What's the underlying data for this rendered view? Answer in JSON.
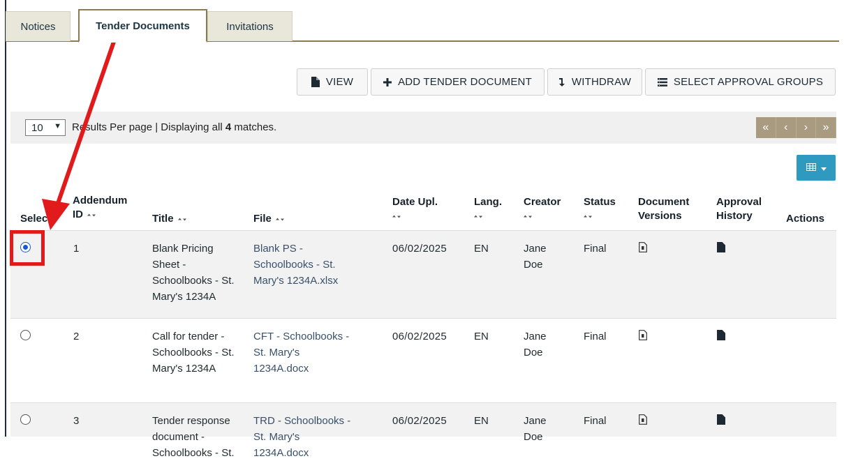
{
  "tabs": [
    {
      "label": "Notices"
    },
    {
      "label": "Tender Documents"
    },
    {
      "label": "Invitations"
    }
  ],
  "toolbar": {
    "view": "VIEW",
    "add": "ADD TENDER DOCUMENT",
    "withdraw": "WITHDRAW",
    "approval_groups": "SELECT APPROVAL GROUPS"
  },
  "results": {
    "per_page": "10",
    "text_before": "Results Per page | Displaying all ",
    "count": "4",
    "text_after": " matches."
  },
  "pager": [
    "«",
    "‹",
    "›",
    "»"
  ],
  "columns": {
    "select": "Select",
    "addendum_1": "Addendum",
    "addendum_2": "ID",
    "title": "Title",
    "file": "File",
    "date": "Date Upl.",
    "lang": "Lang.",
    "creator": "Creator",
    "status": "Status",
    "versions_1": "Document",
    "versions_2": "Versions",
    "approval_1": "Approval",
    "approval_2": "History",
    "actions": "Actions"
  },
  "rows": [
    {
      "selected": true,
      "id": "1",
      "title": [
        "Blank Pricing",
        "Sheet -",
        "Schoolbooks - St.",
        "Mary's 1234A"
      ],
      "file": [
        "Blank PS -",
        "Schoolbooks - St.",
        "Mary's 1234A.xlsx"
      ],
      "date": "06/02/2025",
      "lang": "EN",
      "creator": [
        "Jane",
        "Doe"
      ],
      "status": "Final"
    },
    {
      "selected": false,
      "id": "2",
      "title": [
        "Call for tender -",
        "Schoolbooks - St.",
        "Mary's 1234A"
      ],
      "file": [
        "CFT - Schoolbooks -",
        "St. Mary's",
        "1234A.docx"
      ],
      "date": "06/02/2025",
      "lang": "EN",
      "creator": [
        "Jane",
        "Doe"
      ],
      "status": "Final"
    },
    {
      "selected": false,
      "id": "3",
      "title": [
        "Tender response",
        "document -",
        "Schoolbooks - St."
      ],
      "file": [
        "TRD - Schoolbooks -",
        "St. Mary's",
        "1234A.docx"
      ],
      "date": "06/02/2025",
      "lang": "EN",
      "creator": [
        "Jane",
        "Doe"
      ],
      "status": "Final"
    }
  ],
  "colors": {
    "accent_border": "#8c7a55",
    "pager": "#a89b80",
    "column_button": "#2e9ac0",
    "annotation": "#e11b1b"
  }
}
